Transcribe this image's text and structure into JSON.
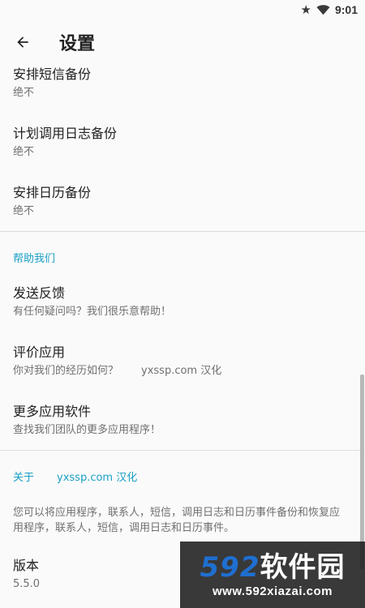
{
  "status_bar": {
    "time": "9:01",
    "icons": [
      "star-icon",
      "wifi-icon"
    ]
  },
  "app_bar": {
    "title": "设置",
    "back_icon": "arrow-back-icon"
  },
  "backup_prefs": [
    {
      "title": "安排短信备份",
      "summary": "绝不"
    },
    {
      "title": "计划调用日志备份",
      "summary": "绝不"
    },
    {
      "title": "安排日历备份",
      "summary": "绝不"
    }
  ],
  "help_category": {
    "title": "帮助我们",
    "items": [
      {
        "title": "发送反馈",
        "summary": "有任何疑问吗？我们很乐意帮助！"
      },
      {
        "title": "评价应用",
        "summary": "你对我们的经历如何？",
        "summary_extra": "yxssp.com 汉化"
      },
      {
        "title": "更多应用软件",
        "summary": "查找我们团队的更多应用程序！"
      }
    ]
  },
  "about_category": {
    "title": "关于",
    "title_extra": "yxssp.com 汉化",
    "description": "您可以将应用程序，联系人，短信，调用日志和日历事件备份和恢复应用程序，联系人，短信，调用日志和日历事件。",
    "version_title": "版本",
    "version_value": "5.5.0"
  },
  "watermark": {
    "brand": "592",
    "brand_cn": "软件园",
    "url": "www.592xiazai.com"
  },
  "colors": {
    "accent": "#1aa0c4",
    "background": "#fafafa",
    "text_primary": "#212121",
    "text_secondary": "#707070"
  }
}
